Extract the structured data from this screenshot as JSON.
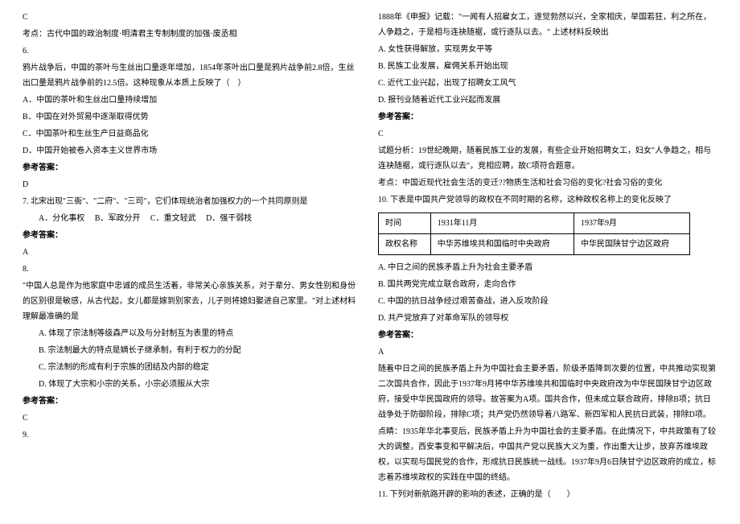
{
  "left": {
    "ans5": "C",
    "kd5": "考点：古代中国的政治制度·明清君主专制制度的加强·废丞相",
    "q6_num": "6.",
    "q6_stem": "鸦片战争后，中国的茶叶与生丝出口量逐年增加，1854年茶叶出口量是鸦片战争前2.8倍，生丝出口量是鸦片战争前的12.5倍。这种现象从本质上反映了（　）",
    "q6_a": "A．中国的茶叶和生丝出口量持续增加",
    "q6_b": "B．中国在对外贸易中逐渐取得优势",
    "q6_c": "C．中国茶叶和生丝生产日益商品化",
    "q6_d": "D．中国开始被卷入资本主义世界市场",
    "ref": "参考答案：",
    "ans6": "D",
    "q7": "7. 北宋出现\"三衙\"、\"二府\"、\"三司\"，它们体现统治者加强权力的一个共同原则是",
    "q7_a": "A．分化事权",
    "q7_b": "B．军政分开",
    "q7_c": "C．重文轻武",
    "q7_d": "D．强干弱枝",
    "ans7": "A",
    "q8_num": "8.",
    "q8_stem": "\"中国人总是作为他家庭中忠诚的成员生活着，非常关心亲族关系，对于辈分、男女性别和身份的区别很是敏感，从古代起，女儿都是嫁到别家去，儿子则将媳妇娶进自己家里。\"对上述材料理解最准确的是",
    "q8_a": "A. 体现了宗法制等级森严以及与分封制互为表里的特点",
    "q8_b": "B. 宗法制最大的特点是嫡长子继承制，有利于权力的分配",
    "q8_c": "C. 宗法制的形成有利于宗族的团结及内部的稳定",
    "q8_d": "D. 体现了大宗和小宗的关系，小宗必须服从大宗",
    "ans8": "C",
    "q9_num": "9."
  },
  "right": {
    "q9_stem": "1888年《申报》记载：\"一闻有人招雇女工，遂觉勃然以兴，全家相庆，举国若狂，利之所在，人争趋之，于是相与连袂随裾，或行逐队以去。\" 上述材料反映出",
    "q9_a": "A. 女性获得解放，实现男女平等",
    "q9_b": "B. 民族工业发展，雇佣关系开始出现",
    "q9_c": "C. 近代工业兴起，出现了招聘女工风气",
    "q9_d": "D. 报刊业随着近代工业兴起而发展",
    "ref": "参考答案：",
    "ans9": "C",
    "q9_exp1": "试题分析：19世纪晚期，随着民族工业的发展，有些企业开始招聘女工，妇女\"人争趋之，相与连袂随裾，或行逐队以去\"，竞相应聘，故C项符合题意。",
    "q9_exp2": "考点：中国近现代社会生活的变迁??物质生活和社会习俗的变化?社会习俗的变化",
    "q10_stem": "10. 下表是中国共产党领导的政权在不同时期的名称，这种政权名称上的变化反映了",
    "t_h1": "时间",
    "t_h2": "1931年11月",
    "t_h3": "1937年9月",
    "t_r1": "政权名称",
    "t_r2": "中华苏维埃共和国临时中央政府",
    "t_r3": "中华民国陕甘宁边区政府",
    "q10_a": "A. 中日之间的民族矛盾上升为社会主要矛盾",
    "q10_b": "B. 国共两党完成立联合政府，走向合作",
    "q10_c": "C. 中国的抗日战争经过艰苦奋战，进入反攻阶段",
    "q10_d": "D. 共产党放弃了对革命军队的领导权",
    "ans10": "A",
    "q10_exp1": "随着中日之间的民族矛盾上升为中国社会主要矛盾，阶级矛盾降到次要的位置，中共推动实现第二次国共合作，因此于1937年9月将中华苏维埃共和国临时中央政府改为中华民国陕甘宁边区政府，接受中华民国政府的领导。故答案为A项。国共合作，但未成立联合政府，排除B项；抗日战争处于防御阶段，排除C项；共产党仍然领导着八路军、新四军和人民抗日武装，排除D项。",
    "q10_exp2": "点睛：1935年华北事变后，民族矛盾上升为中国社会的主要矛盾。在此情况下，中共政策有了较大的调整，西安事变和平解决后，中国共产党以民族大义为重，作出重大让步，放弃苏维埃政权，以实现与国民党的合作，形成抗日民族统一战线。1937年9月6日陕甘宁边区政府的成立，标志着苏维埃政权的实践在中国的终结。",
    "q11": "11. 下列对新航路开辟的影响的表述，正确的是（　　）"
  }
}
